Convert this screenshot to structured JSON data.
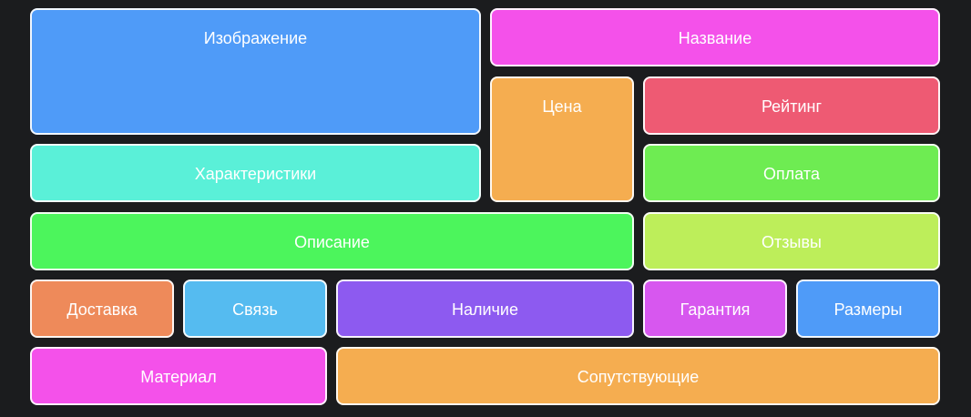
{
  "tiles": {
    "image": {
      "label": "Изображение",
      "color": "#4f9bf8"
    },
    "name": {
      "label": "Название",
      "color": "#f451ea"
    },
    "price": {
      "label": "Цена",
      "color": "#f5ad50"
    },
    "rating": {
      "label": "Рейтинг",
      "color": "#ee5a73"
    },
    "specs": {
      "label": "Характеристики",
      "color": "#5af0d8"
    },
    "payment": {
      "label": "Оплата",
      "color": "#6eec52"
    },
    "description": {
      "label": "Описание",
      "color": "#4cf55c"
    },
    "reviews": {
      "label": "Отзывы",
      "color": "#bdee5a"
    },
    "delivery": {
      "label": "Доставка",
      "color": "#ee8a5a"
    },
    "contact": {
      "label": "Связь",
      "color": "#55bbf0"
    },
    "stock": {
      "label": "Наличие",
      "color": "#8d5af0"
    },
    "warranty": {
      "label": "Гарантия",
      "color": "#d757ef"
    },
    "sizes": {
      "label": "Размеры",
      "color": "#4f9bf8"
    },
    "material": {
      "label": "Материал",
      "color": "#f451ea"
    },
    "related": {
      "label": "Сопутствующие",
      "color": "#f5ad50"
    }
  },
  "background": "#1b1c1e"
}
